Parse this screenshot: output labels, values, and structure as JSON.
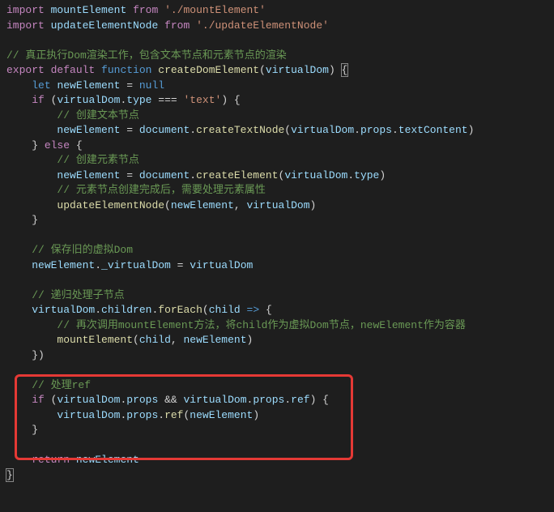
{
  "code": {
    "lines": [
      {
        "indent": 0,
        "segments": [
          {
            "cls": "tk-keyword-import",
            "t": "import"
          },
          {
            "cls": "tk-punct",
            "t": " "
          },
          {
            "cls": "tk-variable",
            "t": "mountElement"
          },
          {
            "cls": "tk-punct",
            "t": " "
          },
          {
            "cls": "tk-keyword-import",
            "t": "from"
          },
          {
            "cls": "tk-punct",
            "t": " "
          },
          {
            "cls": "tk-string",
            "t": "'./mountElement'"
          }
        ]
      },
      {
        "indent": 0,
        "segments": [
          {
            "cls": "tk-keyword-import",
            "t": "import"
          },
          {
            "cls": "tk-punct",
            "t": " "
          },
          {
            "cls": "tk-variable",
            "t": "updateElementNode"
          },
          {
            "cls": "tk-punct",
            "t": " "
          },
          {
            "cls": "tk-keyword-import",
            "t": "from"
          },
          {
            "cls": "tk-punct",
            "t": " "
          },
          {
            "cls": "tk-string",
            "t": "'./updateElementNode'"
          }
        ]
      },
      {
        "indent": 0,
        "segments": []
      },
      {
        "indent": 0,
        "segments": [
          {
            "cls": "tk-comment",
            "t": "// 真正执行Dom渲染工作，包含文本节点和元素节点的渲染"
          }
        ]
      },
      {
        "indent": 0,
        "segments": [
          {
            "cls": "tk-keyword-import",
            "t": "export"
          },
          {
            "cls": "tk-punct",
            "t": " "
          },
          {
            "cls": "tk-keyword-import",
            "t": "default"
          },
          {
            "cls": "tk-punct",
            "t": " "
          },
          {
            "cls": "tk-keyword-decl",
            "t": "function"
          },
          {
            "cls": "tk-punct",
            "t": " "
          },
          {
            "cls": "tk-function",
            "t": "createDomElement"
          },
          {
            "cls": "tk-punct",
            "t": "("
          },
          {
            "cls": "tk-param",
            "t": "virtualDom"
          },
          {
            "cls": "tk-punct",
            "t": ") "
          },
          {
            "cls": "tk-brace brace-highlight",
            "t": "{"
          }
        ]
      },
      {
        "indent": 1,
        "segments": [
          {
            "cls": "tk-keyword-decl",
            "t": "let"
          },
          {
            "cls": "tk-punct",
            "t": " "
          },
          {
            "cls": "tk-variable",
            "t": "newElement"
          },
          {
            "cls": "tk-punct",
            "t": " = "
          },
          {
            "cls": "tk-const",
            "t": "null"
          }
        ]
      },
      {
        "indent": 1,
        "segments": [
          {
            "cls": "tk-keyword-control",
            "t": "if"
          },
          {
            "cls": "tk-punct",
            "t": " ("
          },
          {
            "cls": "tk-variable",
            "t": "virtualDom"
          },
          {
            "cls": "tk-punct",
            "t": "."
          },
          {
            "cls": "tk-variable",
            "t": "type"
          },
          {
            "cls": "tk-punct",
            "t": " === "
          },
          {
            "cls": "tk-string",
            "t": "'text'"
          },
          {
            "cls": "tk-punct",
            "t": ") {"
          }
        ]
      },
      {
        "indent": 2,
        "segments": [
          {
            "cls": "tk-comment",
            "t": "// 创建文本节点"
          }
        ]
      },
      {
        "indent": 2,
        "segments": [
          {
            "cls": "tk-variable",
            "t": "newElement"
          },
          {
            "cls": "tk-punct",
            "t": " = "
          },
          {
            "cls": "tk-variable",
            "t": "document"
          },
          {
            "cls": "tk-punct",
            "t": "."
          },
          {
            "cls": "tk-function",
            "t": "createTextNode"
          },
          {
            "cls": "tk-punct",
            "t": "("
          },
          {
            "cls": "tk-variable",
            "t": "virtualDom"
          },
          {
            "cls": "tk-punct",
            "t": "."
          },
          {
            "cls": "tk-variable",
            "t": "props"
          },
          {
            "cls": "tk-punct",
            "t": "."
          },
          {
            "cls": "tk-variable",
            "t": "textContent"
          },
          {
            "cls": "tk-punct",
            "t": ")"
          }
        ]
      },
      {
        "indent": 1,
        "segments": [
          {
            "cls": "tk-punct",
            "t": "} "
          },
          {
            "cls": "tk-keyword-control",
            "t": "else"
          },
          {
            "cls": "tk-punct",
            "t": " {"
          }
        ]
      },
      {
        "indent": 2,
        "segments": [
          {
            "cls": "tk-comment",
            "t": "// 创建元素节点"
          }
        ]
      },
      {
        "indent": 2,
        "segments": [
          {
            "cls": "tk-variable",
            "t": "newElement"
          },
          {
            "cls": "tk-punct",
            "t": " = "
          },
          {
            "cls": "tk-variable",
            "t": "document"
          },
          {
            "cls": "tk-punct",
            "t": "."
          },
          {
            "cls": "tk-function",
            "t": "createElement"
          },
          {
            "cls": "tk-punct",
            "t": "("
          },
          {
            "cls": "tk-variable",
            "t": "virtualDom"
          },
          {
            "cls": "tk-punct",
            "t": "."
          },
          {
            "cls": "tk-variable",
            "t": "type"
          },
          {
            "cls": "tk-punct",
            "t": ")"
          }
        ]
      },
      {
        "indent": 2,
        "segments": [
          {
            "cls": "tk-comment",
            "t": "// 元素节点创建完成后，需要处理元素属性"
          }
        ]
      },
      {
        "indent": 2,
        "segments": [
          {
            "cls": "tk-function",
            "t": "updateElementNode"
          },
          {
            "cls": "tk-punct",
            "t": "("
          },
          {
            "cls": "tk-variable",
            "t": "newElement"
          },
          {
            "cls": "tk-punct",
            "t": ", "
          },
          {
            "cls": "tk-variable",
            "t": "virtualDom"
          },
          {
            "cls": "tk-punct",
            "t": ")"
          }
        ]
      },
      {
        "indent": 1,
        "segments": [
          {
            "cls": "tk-punct",
            "t": "}"
          }
        ]
      },
      {
        "indent": 0,
        "segments": []
      },
      {
        "indent": 1,
        "segments": [
          {
            "cls": "tk-comment",
            "t": "// 保存旧的虚拟Dom"
          }
        ]
      },
      {
        "indent": 1,
        "segments": [
          {
            "cls": "tk-variable",
            "t": "newElement"
          },
          {
            "cls": "tk-punct",
            "t": "."
          },
          {
            "cls": "tk-variable",
            "t": "_virtualDom"
          },
          {
            "cls": "tk-punct",
            "t": " = "
          },
          {
            "cls": "tk-variable",
            "t": "virtualDom"
          }
        ]
      },
      {
        "indent": 0,
        "segments": []
      },
      {
        "indent": 1,
        "segments": [
          {
            "cls": "tk-comment",
            "t": "// 递归处理子节点"
          }
        ]
      },
      {
        "indent": 1,
        "segments": [
          {
            "cls": "tk-variable",
            "t": "virtualDom"
          },
          {
            "cls": "tk-punct",
            "t": "."
          },
          {
            "cls": "tk-variable",
            "t": "children"
          },
          {
            "cls": "tk-punct",
            "t": "."
          },
          {
            "cls": "tk-function",
            "t": "forEach"
          },
          {
            "cls": "tk-punct",
            "t": "("
          },
          {
            "cls": "tk-param",
            "t": "child"
          },
          {
            "cls": "tk-punct",
            "t": " "
          },
          {
            "cls": "tk-keyword-decl",
            "t": "=>"
          },
          {
            "cls": "tk-punct",
            "t": " {"
          }
        ]
      },
      {
        "indent": 2,
        "segments": [
          {
            "cls": "tk-comment",
            "t": "// 再次调用mountElement方法，将child作为虚拟Dom节点，newElement作为容器"
          }
        ]
      },
      {
        "indent": 2,
        "segments": [
          {
            "cls": "tk-function",
            "t": "mountElement"
          },
          {
            "cls": "tk-punct",
            "t": "("
          },
          {
            "cls": "tk-variable",
            "t": "child"
          },
          {
            "cls": "tk-punct",
            "t": ", "
          },
          {
            "cls": "tk-variable",
            "t": "newElement"
          },
          {
            "cls": "tk-punct",
            "t": ")"
          }
        ]
      },
      {
        "indent": 1,
        "segments": [
          {
            "cls": "tk-punct",
            "t": "})"
          }
        ]
      },
      {
        "indent": 0,
        "segments": []
      },
      {
        "indent": 1,
        "segments": [
          {
            "cls": "tk-comment",
            "t": "// 处理ref"
          }
        ]
      },
      {
        "indent": 1,
        "segments": [
          {
            "cls": "tk-keyword-control",
            "t": "if"
          },
          {
            "cls": "tk-punct",
            "t": " ("
          },
          {
            "cls": "tk-variable",
            "t": "virtualDom"
          },
          {
            "cls": "tk-punct",
            "t": "."
          },
          {
            "cls": "tk-variable",
            "t": "props"
          },
          {
            "cls": "tk-punct",
            "t": " && "
          },
          {
            "cls": "tk-variable",
            "t": "virtualDom"
          },
          {
            "cls": "tk-punct",
            "t": "."
          },
          {
            "cls": "tk-variable",
            "t": "props"
          },
          {
            "cls": "tk-punct",
            "t": "."
          },
          {
            "cls": "tk-variable",
            "t": "ref"
          },
          {
            "cls": "tk-punct",
            "t": ") {"
          }
        ]
      },
      {
        "indent": 2,
        "segments": [
          {
            "cls": "tk-variable",
            "t": "virtualDom"
          },
          {
            "cls": "tk-punct",
            "t": "."
          },
          {
            "cls": "tk-variable",
            "t": "props"
          },
          {
            "cls": "tk-punct",
            "t": "."
          },
          {
            "cls": "tk-function",
            "t": "ref"
          },
          {
            "cls": "tk-punct",
            "t": "("
          },
          {
            "cls": "tk-variable",
            "t": "newElement"
          },
          {
            "cls": "tk-punct",
            "t": ")"
          }
        ]
      },
      {
        "indent": 1,
        "segments": [
          {
            "cls": "tk-punct",
            "t": "}"
          }
        ]
      },
      {
        "indent": 0,
        "segments": []
      },
      {
        "indent": 1,
        "segments": [
          {
            "cls": "tk-keyword-control",
            "t": "return"
          },
          {
            "cls": "tk-punct",
            "t": " "
          },
          {
            "cls": "tk-variable",
            "t": "newElement"
          }
        ]
      },
      {
        "indent": 0,
        "segments": [
          {
            "cls": "tk-brace brace-highlight",
            "t": "}"
          }
        ]
      }
    ]
  },
  "highlight_range": {
    "start_line_index": 25,
    "end_line_index": 28
  }
}
